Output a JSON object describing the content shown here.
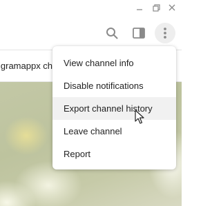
{
  "window_controls": {
    "minimize_icon": "minimize-icon",
    "restore_icon": "restore-icon",
    "close_icon": "close-icon"
  },
  "header": {
    "search_icon": "search-icon",
    "sidebar_icon": "sidebar-toggle-icon",
    "more_icon": "more-vertical-icon"
  },
  "pinned_bar": {
    "text": "igramappx ch"
  },
  "menu": {
    "items": [
      {
        "label": "View channel info"
      },
      {
        "label": "Disable notifications"
      },
      {
        "label": "Export channel history"
      },
      {
        "label": "Leave channel"
      },
      {
        "label": "Report"
      }
    ],
    "hovered_item": "Export channel history"
  },
  "colors": {
    "icon": "#8a8a8a",
    "hover_bg": "#f1f1f1",
    "text": "#222222"
  }
}
